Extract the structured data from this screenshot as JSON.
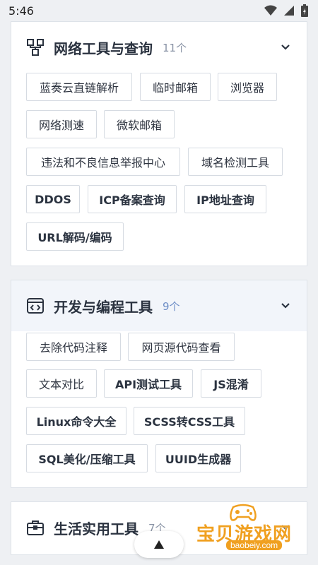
{
  "status": {
    "time": "5:46"
  },
  "sections": [
    {
      "title": "网络工具与查询",
      "count": "11个",
      "icon": "network-icon",
      "tools": [
        "蓝奏云直链解析",
        "临时邮箱",
        "浏览器",
        "网络测速",
        "微软邮箱",
        "违法和不良信息举报中心",
        "域名检测工具",
        "DDOS",
        "ICP备案查询",
        "IP地址查询",
        "URL解码/编码"
      ]
    },
    {
      "title": "开发与编程工具",
      "count": "9个",
      "icon": "code-window-icon",
      "tools": [
        "去除代码注释",
        "网页源代码查看",
        "文本对比",
        "API测试工具",
        "JS混淆",
        "Linux命令大全",
        "SCSS转CSS工具",
        "SQL美化/压缩工具",
        "UUID生成器"
      ]
    },
    {
      "title": "生活实用工具",
      "count": "7个",
      "icon": "briefcase-icon",
      "tools": []
    }
  ],
  "watermark": {
    "text": "宝贝游戏网",
    "url": "baobeiy.com"
  }
}
